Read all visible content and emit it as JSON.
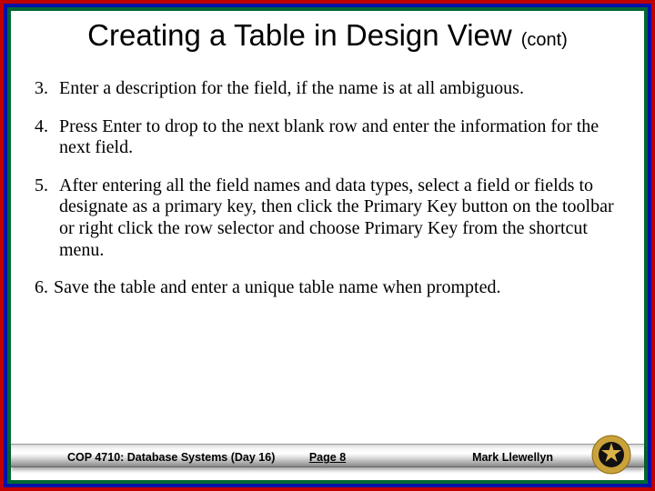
{
  "title": {
    "main": "Creating a Table in Design View",
    "cont": "(cont)"
  },
  "items": {
    "n3": "3.",
    "t3": "Enter a description for the field, if the name is at all ambiguous.",
    "n4": "4.",
    "t4": "Press Enter to drop to the next blank row and enter the information for the next field.",
    "n5": "5.",
    "t5": "After entering all the field names and data types, select a field or fields to designate as a primary key, then click the Primary Key button on the toolbar or right click the row selector and choose Primary Key from the shortcut menu.",
    "n6": "6.",
    "t6": "Save the table and enter a unique table name when prompted."
  },
  "footer": {
    "course": "COP 4710: Database Systems (Day 16)",
    "page": "Page 8",
    "author": "Mark Llewellyn"
  }
}
